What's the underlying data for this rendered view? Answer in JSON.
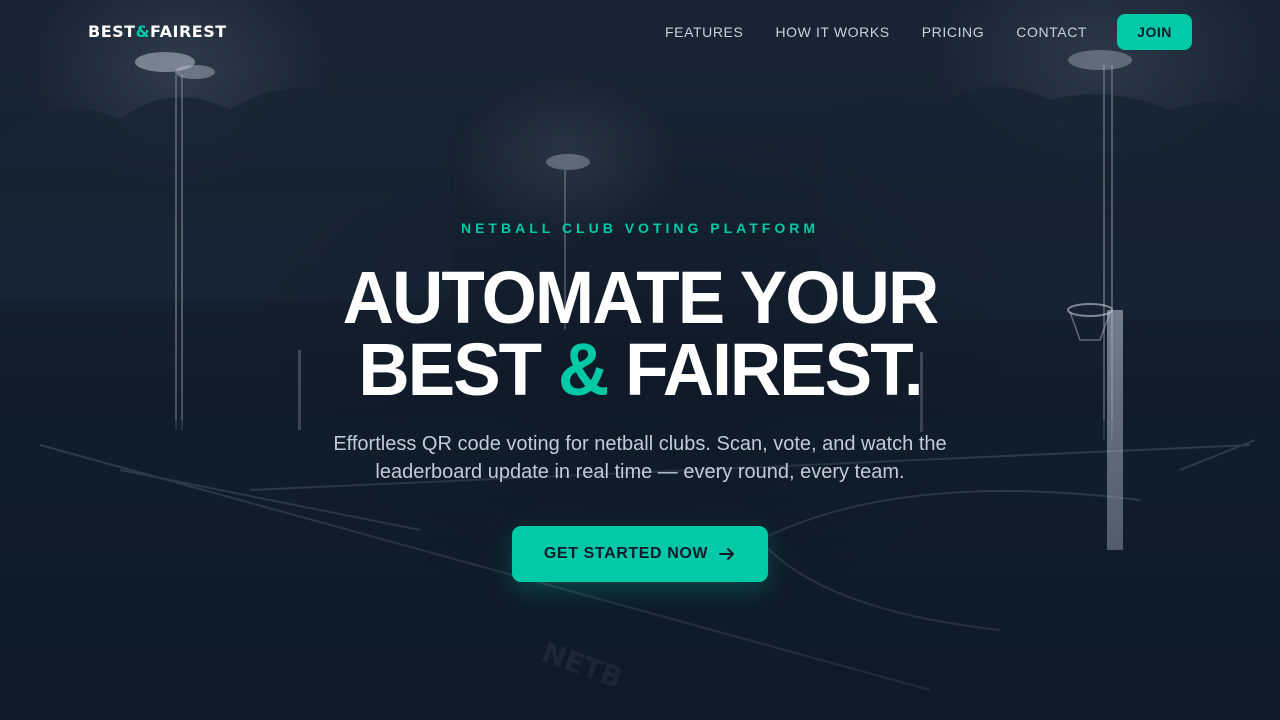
{
  "brand": {
    "logo_left": "BEST",
    "logo_amp": "&",
    "logo_right": "FAIREST"
  },
  "nav": {
    "links": [
      "FEATURES",
      "HOW IT WORKS",
      "PRICING",
      "CONTACT"
    ],
    "join_label": "JOIN"
  },
  "hero": {
    "eyebrow": "NETBALL CLUB VOTING PLATFORM",
    "headline_line1": "AUTOMATE YOUR",
    "headline_line2_left": "BEST",
    "headline_amp": "&",
    "headline_line2_right": "FAIREST.",
    "subtitle": "Effortless QR code voting for netball clubs. Scan, vote, and watch the leaderboard update in real time — every round, every team.",
    "cta_label": "GET STARTED NOW",
    "cta_icon": "arrow-right-icon"
  },
  "colors": {
    "accent": "#00c9a7",
    "background": "#0f1c2b",
    "text": "#ffffff",
    "muted_text": "#c3cbd5"
  }
}
